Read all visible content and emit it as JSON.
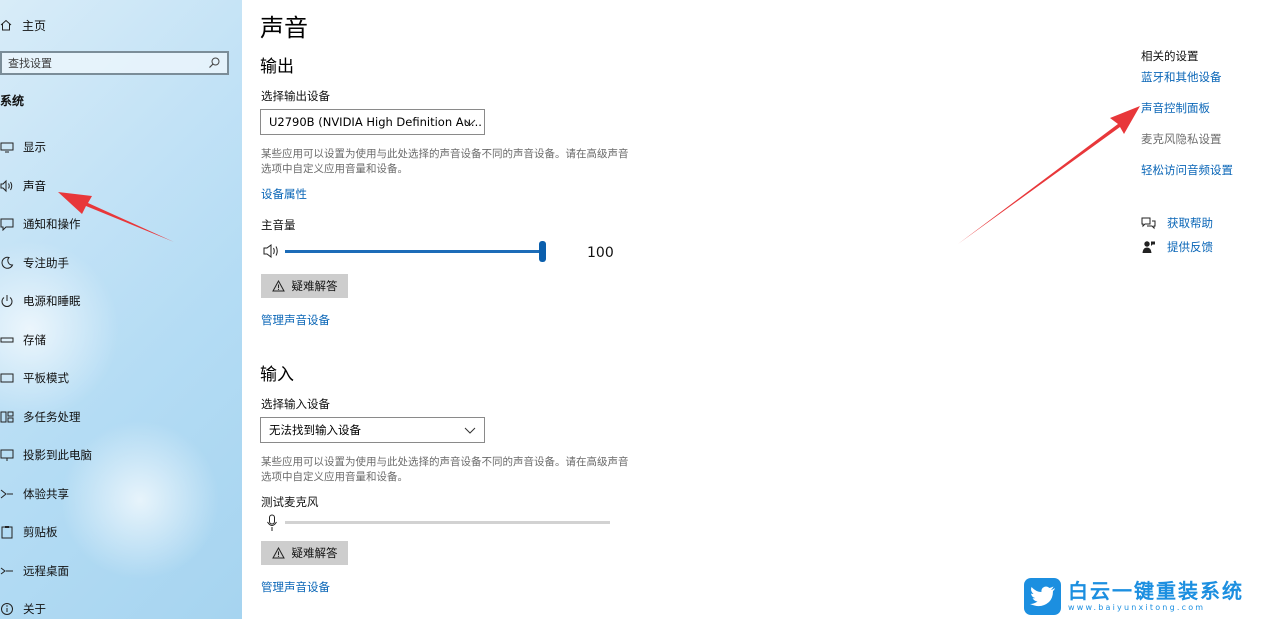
{
  "sidebar": {
    "home_label": "主页",
    "search_placeholder": "查找设置",
    "section_title": "系统",
    "items": [
      {
        "label": "显示",
        "icon": "display-icon"
      },
      {
        "label": "声音",
        "icon": "speaker-icon"
      },
      {
        "label": "通知和操作",
        "icon": "notification-icon"
      },
      {
        "label": "专注助手",
        "icon": "moon-icon"
      },
      {
        "label": "电源和睡眠",
        "icon": "power-icon"
      },
      {
        "label": "存储",
        "icon": "storage-icon"
      },
      {
        "label": "平板模式",
        "icon": "tablet-icon"
      },
      {
        "label": "多任务处理",
        "icon": "multitask-icon"
      },
      {
        "label": "投影到此电脑",
        "icon": "project-icon"
      },
      {
        "label": "体验共享",
        "icon": "share-icon"
      },
      {
        "label": "剪贴板",
        "icon": "clipboard-icon"
      },
      {
        "label": "远程桌面",
        "icon": "remote-desktop-icon"
      },
      {
        "label": "关于",
        "icon": "info-icon"
      }
    ]
  },
  "main": {
    "title": "声音",
    "output": {
      "heading": "输出",
      "device_label": "选择输出设备",
      "device_value": "U2790B (NVIDIA High Definition Au...",
      "description": "某些应用可以设置为使用与此处选择的声音设备不同的声音设备。请在高级声音选项中自定义应用音量和设备。",
      "properties_link": "设备属性",
      "volume_label": "主音量",
      "volume_value": "100",
      "volume_level": 100,
      "troubleshoot_label": "疑难解答",
      "manage_link": "管理声音设备"
    },
    "input": {
      "heading": "输入",
      "device_label": "选择输入设备",
      "device_value": "无法找到输入设备",
      "description": "某些应用可以设置为使用与此处选择的声音设备不同的声音设备。请在高级声音选项中自定义应用音量和设备。",
      "test_label": "测试麦克风",
      "troubleshoot_label": "疑难解答",
      "manage_link": "管理声音设备"
    }
  },
  "related": {
    "title": "相关的设置",
    "links": [
      "蓝牙和其他设备",
      "声音控制面板",
      "麦克风隐私设置",
      "轻松访问音频设置"
    ],
    "help": "获取帮助",
    "feedback": "提供反馈"
  },
  "watermark": {
    "cn": "白云一键重装系统",
    "en": "www.baiyunxitong.com"
  },
  "colors": {
    "accent": "#0a66b7",
    "slider": "#1c6cb8",
    "arrow": "#e8373a",
    "watermark": "#1c8fe0"
  }
}
